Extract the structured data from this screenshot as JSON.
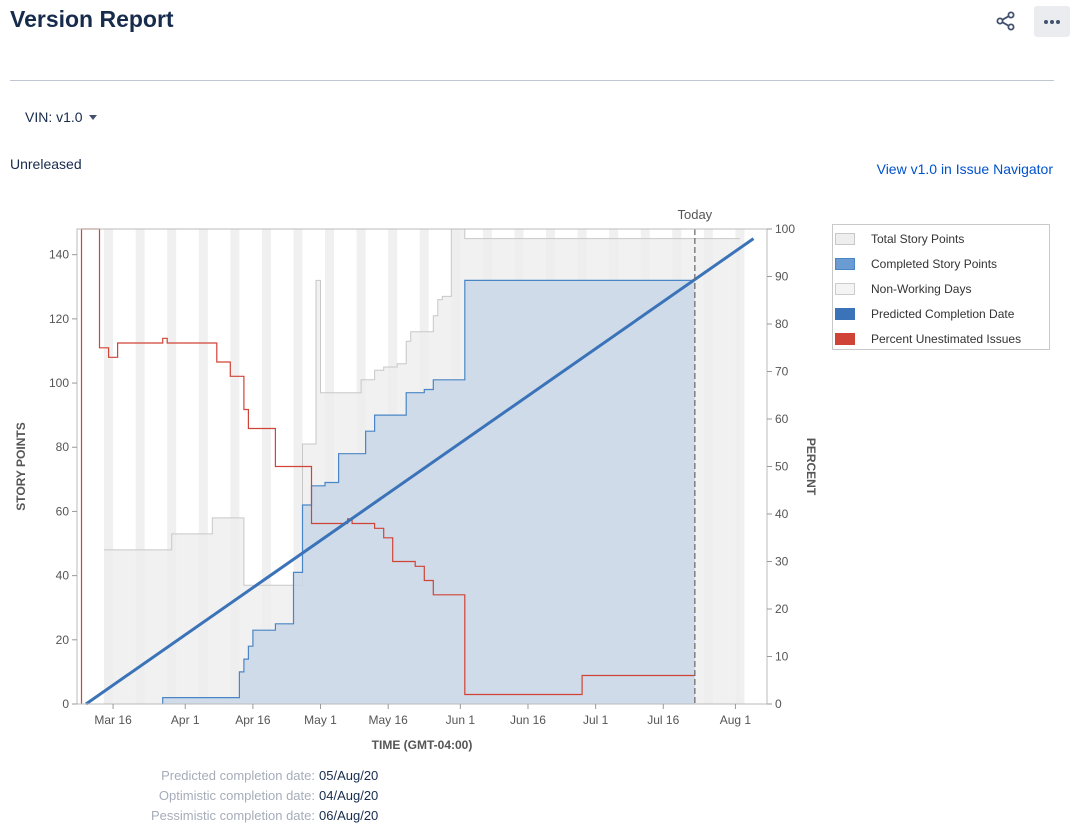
{
  "header": {
    "title": "Version Report"
  },
  "icons": {
    "share": "share-icon",
    "more": "more-icon"
  },
  "version_select": {
    "label": "VIN: v1.0"
  },
  "status": "Unreleased",
  "nav_link": "View v1.0 in Issue Navigator",
  "colors": {
    "predicted": "#3b73b9",
    "completed_line": "#4a86c5",
    "completed_fill": "#c9d7e8",
    "total_fill": "#eeeeee",
    "total_line": "#c8c8c8",
    "non_working": "#f0f0f0",
    "unestimated": "#d04437",
    "today_line": "#707070"
  },
  "chart_data": {
    "type": "line",
    "xlabel": "TIME (GMT-04:00)",
    "ylabel": "STORY POINTS",
    "y2label": "PERCENT",
    "annotation": "Today",
    "today": "2020-07-23",
    "xlim": [
      "2020-03-08",
      "2020-08-08"
    ],
    "x_ticks": [
      "Mar 16",
      "Apr 1",
      "Apr 16",
      "May 1",
      "May 16",
      "Jun 1",
      "Jun 16",
      "Jul 1",
      "Jul 16",
      "Aug 1"
    ],
    "x_tick_dates": [
      "2020-03-16",
      "2020-04-01",
      "2020-04-16",
      "2020-05-01",
      "2020-05-16",
      "2020-06-01",
      "2020-06-16",
      "2020-07-01",
      "2020-07-16",
      "2020-08-01"
    ],
    "ylim": [
      0,
      148
    ],
    "y_ticks": [
      0,
      20,
      40,
      60,
      80,
      100,
      120,
      140
    ],
    "y2lim": [
      0,
      100
    ],
    "y2_ticks": [
      0,
      10,
      20,
      30,
      40,
      50,
      60,
      70,
      80,
      90,
      100
    ],
    "legend": {
      "position": "right",
      "items": [
        {
          "name": "Total Story Points",
          "color": "#eeeeee",
          "border": "#c8c8c8"
        },
        {
          "name": "Completed Story Points",
          "color": "#6a9bd1",
          "border": "#4a86c5"
        },
        {
          "name": "Non-Working Days",
          "color": "#f4f4f4",
          "border": "#cccccc"
        },
        {
          "name": "Predicted Completion Date",
          "color": "#3b73b9",
          "border": "#3b73b9"
        },
        {
          "name": "Percent Unestimated Issues",
          "color": "#d04437",
          "border": "#d04437"
        }
      ]
    },
    "series": [
      {
        "name": "Total Story Points",
        "axis": "left",
        "points": [
          [
            "2020-03-14",
            48
          ],
          [
            "2020-03-29",
            48
          ],
          [
            "2020-03-29",
            53
          ],
          [
            "2020-04-07",
            53
          ],
          [
            "2020-04-07",
            58
          ],
          [
            "2020-04-14",
            58
          ],
          [
            "2020-04-14",
            37
          ],
          [
            "2020-04-21",
            37
          ],
          [
            "2020-04-21",
            37
          ],
          [
            "2020-04-27",
            37
          ],
          [
            "2020-04-27",
            81
          ],
          [
            "2020-04-28",
            81
          ],
          [
            "2020-04-28",
            81
          ],
          [
            "2020-04-30",
            81
          ],
          [
            "2020-04-30",
            132
          ],
          [
            "2020-05-01",
            132
          ],
          [
            "2020-05-01",
            97
          ],
          [
            "2020-05-03",
            97
          ],
          [
            "2020-05-03",
            97
          ],
          [
            "2020-05-05",
            97
          ],
          [
            "2020-05-05",
            97
          ],
          [
            "2020-05-07",
            97
          ],
          [
            "2020-05-07",
            97
          ],
          [
            "2020-05-09",
            97
          ],
          [
            "2020-05-09",
            97
          ],
          [
            "2020-05-10",
            97
          ],
          [
            "2020-05-10",
            101
          ],
          [
            "2020-05-13",
            101
          ],
          [
            "2020-05-13",
            104
          ],
          [
            "2020-05-15",
            104
          ],
          [
            "2020-05-15",
            105
          ],
          [
            "2020-05-18",
            105
          ],
          [
            "2020-05-18",
            106
          ],
          [
            "2020-05-20",
            106
          ],
          [
            "2020-05-20",
            113
          ],
          [
            "2020-05-21",
            113
          ],
          [
            "2020-05-21",
            116
          ],
          [
            "2020-05-22",
            116
          ],
          [
            "2020-05-22",
            116
          ],
          [
            "2020-05-26",
            116
          ],
          [
            "2020-05-26",
            121
          ],
          [
            "2020-05-27",
            121
          ],
          [
            "2020-05-27",
            126
          ],
          [
            "2020-05-28",
            126
          ],
          [
            "2020-05-28",
            127
          ],
          [
            "2020-05-30",
            127
          ],
          [
            "2020-05-30",
            148
          ],
          [
            "2020-06-02",
            148
          ],
          [
            "2020-06-02",
            145
          ],
          [
            "2020-08-02",
            145
          ]
        ]
      },
      {
        "name": "Completed Story Points",
        "axis": "left",
        "points": [
          [
            "2020-03-27",
            0
          ],
          [
            "2020-03-27",
            2
          ],
          [
            "2020-04-13",
            2
          ],
          [
            "2020-04-13",
            10
          ],
          [
            "2020-04-14",
            10
          ],
          [
            "2020-04-14",
            14
          ],
          [
            "2020-04-15",
            14
          ],
          [
            "2020-04-15",
            18
          ],
          [
            "2020-04-16",
            18
          ],
          [
            "2020-04-16",
            23
          ],
          [
            "2020-04-21",
            23
          ],
          [
            "2020-04-21",
            25
          ],
          [
            "2020-04-25",
            25
          ],
          [
            "2020-04-25",
            41
          ],
          [
            "2020-04-27",
            41
          ],
          [
            "2020-04-27",
            62
          ],
          [
            "2020-04-29",
            62
          ],
          [
            "2020-04-29",
            68
          ],
          [
            "2020-05-02",
            68
          ],
          [
            "2020-05-02",
            69
          ],
          [
            "2020-05-05",
            69
          ],
          [
            "2020-05-05",
            78
          ],
          [
            "2020-05-11",
            78
          ],
          [
            "2020-05-11",
            85
          ],
          [
            "2020-05-13",
            85
          ],
          [
            "2020-05-13",
            90
          ],
          [
            "2020-05-20",
            90
          ],
          [
            "2020-05-20",
            97
          ],
          [
            "2020-05-24",
            97
          ],
          [
            "2020-05-24",
            98
          ],
          [
            "2020-05-26",
            98
          ],
          [
            "2020-05-26",
            101
          ],
          [
            "2020-06-02",
            101
          ],
          [
            "2020-06-02",
            132
          ],
          [
            "2020-07-23",
            132
          ]
        ]
      },
      {
        "name": "Percent Unestimated Issues",
        "axis": "right",
        "points": [
          [
            "2020-03-09",
            0
          ],
          [
            "2020-03-09",
            100
          ],
          [
            "2020-03-13",
            100
          ],
          [
            "2020-03-13",
            75
          ],
          [
            "2020-03-15",
            75
          ],
          [
            "2020-03-15",
            73
          ],
          [
            "2020-03-17",
            73
          ],
          [
            "2020-03-17",
            76
          ],
          [
            "2020-03-27",
            76
          ],
          [
            "2020-03-27",
            77
          ],
          [
            "2020-03-28",
            77
          ],
          [
            "2020-03-28",
            76
          ],
          [
            "2020-04-08",
            76
          ],
          [
            "2020-04-08",
            72
          ],
          [
            "2020-04-11",
            72
          ],
          [
            "2020-04-11",
            69
          ],
          [
            "2020-04-14",
            69
          ],
          [
            "2020-04-14",
            62
          ],
          [
            "2020-04-15",
            62
          ],
          [
            "2020-04-15",
            58
          ],
          [
            "2020-04-21",
            58
          ],
          [
            "2020-04-21",
            50
          ],
          [
            "2020-04-25",
            50
          ],
          [
            "2020-04-25",
            50
          ],
          [
            "2020-04-29",
            50
          ],
          [
            "2020-04-29",
            38
          ],
          [
            "2020-05-07",
            38
          ],
          [
            "2020-05-07",
            39
          ],
          [
            "2020-05-08",
            39
          ],
          [
            "2020-05-08",
            38
          ],
          [
            "2020-05-13",
            38
          ],
          [
            "2020-05-13",
            37
          ],
          [
            "2020-05-15",
            37
          ],
          [
            "2020-05-15",
            35
          ],
          [
            "2020-05-17",
            35
          ],
          [
            "2020-05-17",
            30
          ],
          [
            "2020-05-22",
            30
          ],
          [
            "2020-05-22",
            29
          ],
          [
            "2020-05-24",
            29
          ],
          [
            "2020-05-24",
            26
          ],
          [
            "2020-05-26",
            26
          ],
          [
            "2020-05-26",
            23
          ],
          [
            "2020-06-02",
            23
          ],
          [
            "2020-06-02",
            2
          ],
          [
            "2020-06-28",
            2
          ],
          [
            "2020-06-28",
            6
          ],
          [
            "2020-07-23",
            6
          ]
        ]
      },
      {
        "name": "Predicted Completion Date",
        "axis": "left",
        "points": [
          [
            "2020-03-10",
            0
          ],
          [
            "2020-08-05",
            145
          ]
        ]
      }
    ]
  },
  "completion": [
    {
      "label": "Predicted completion date:",
      "value": "05/Aug/20"
    },
    {
      "label": "Optimistic completion date:",
      "value": "04/Aug/20"
    },
    {
      "label": "Pessimistic completion date:",
      "value": "06/Aug/20"
    }
  ]
}
